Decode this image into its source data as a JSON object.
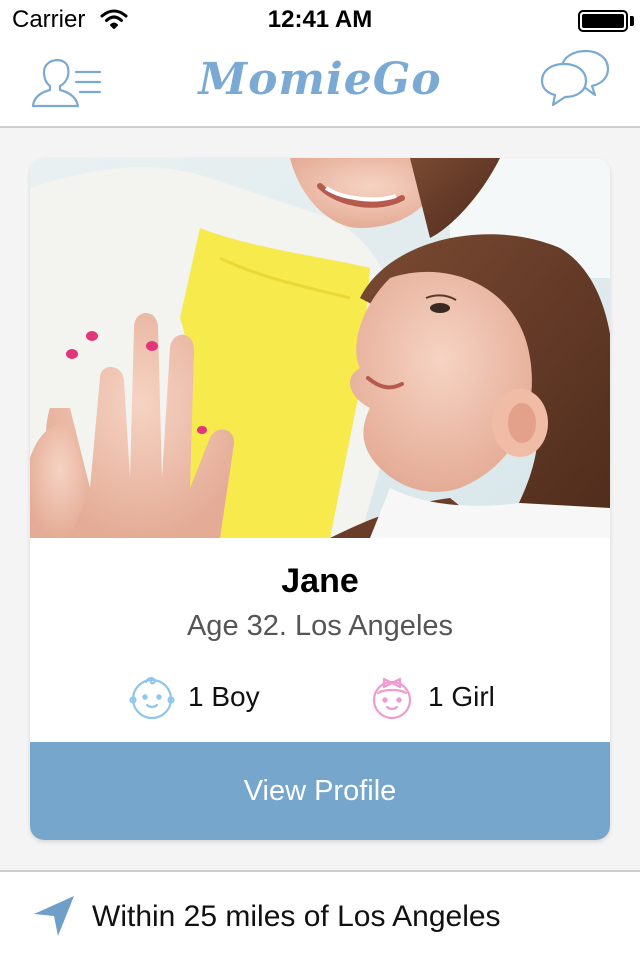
{
  "status_bar": {
    "carrier": "Carrier",
    "time": "12:41 AM",
    "wifi_icon": "wifi-icon",
    "battery_icon": "battery-icon",
    "battery_level": 1.0
  },
  "nav": {
    "brand": "MomieGo",
    "left_icon": "profile-list-icon",
    "right_icon": "chat-bubbles-icon",
    "accent_color": "#7aaad3"
  },
  "card": {
    "photo": "mother-and-daughter-high-five-photo",
    "name": "Jane",
    "subtitle": "Age 32. Los Angeles",
    "kids": [
      {
        "icon": "baby-boy-icon",
        "label": "1 Boy",
        "color": "#8fc6ec"
      },
      {
        "icon": "baby-girl-icon",
        "label": "1 Girl",
        "color": "#f09ad0"
      }
    ],
    "button_label": "View Profile",
    "button_color": "#76a6cb"
  },
  "location": {
    "icon": "location-arrow-icon",
    "text": "Within 25 miles of Los Angeles",
    "icon_color": "#6f9fc8"
  }
}
